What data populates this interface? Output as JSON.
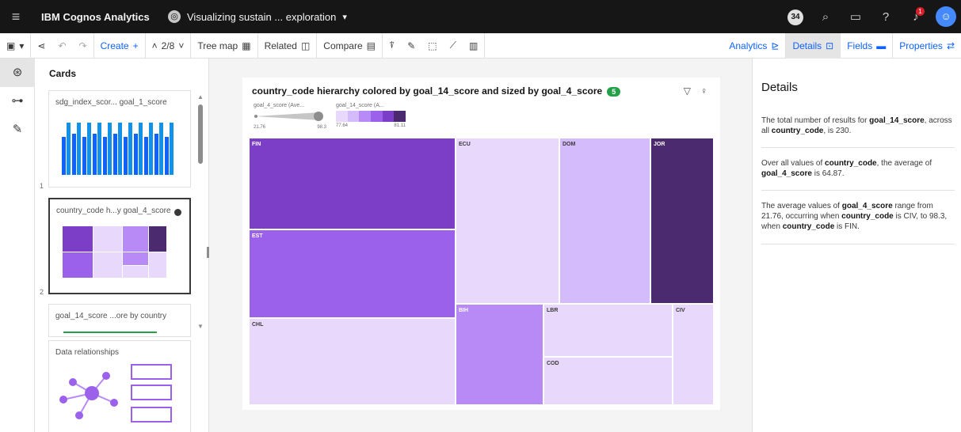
{
  "app": {
    "brand": "IBM Cognos Analytics",
    "doc_title": "Visualizing sustain ... exploration",
    "notification_count": "34",
    "alert_count": "1"
  },
  "toolbar": {
    "create": "Create",
    "page_indicator": "2/8",
    "tree_map": "Tree map",
    "related": "Related",
    "compare": "Compare",
    "analytics": "Analytics",
    "details": "Details",
    "fields": "Fields",
    "properties": "Properties"
  },
  "cards_panel": {
    "title": "Cards",
    "cards": [
      {
        "label": "sdg_index_scor... goal_1_score",
        "number": "1"
      },
      {
        "label": "country_code h...y goal_4_score",
        "number": "2"
      },
      {
        "label": "goal_14_score ...ore by country",
        "number": ""
      },
      {
        "label": "Data relationships",
        "number": ""
      }
    ]
  },
  "viz": {
    "title": "country_code hierarchy colored by goal_14_score and sized by goal_4_score",
    "badge": "5",
    "legend_size_label": "goal_4_score (Ave...",
    "legend_size_min": "21.76",
    "legend_size_max": "98.3",
    "legend_color_label": "goal_14_score (A...",
    "legend_color_min": "77.64",
    "legend_color_max": "81.11",
    "colors": [
      "#e8d9fc",
      "#d4bbfb",
      "#b88af5",
      "#9b61ea",
      "#7c3dc7",
      "#4c2a70"
    ]
  },
  "chart_data": {
    "type": "treemap",
    "title": "country_code hierarchy colored by goal_14_score and sized by goal_4_score",
    "size_measure": "goal_4_score (Ave...",
    "color_measure": "goal_14_score (A...",
    "size_range": [
      21.76,
      98.3
    ],
    "color_range": [
      77.64,
      81.11
    ],
    "nodes": [
      {
        "label": "FIN",
        "color_level": 4
      },
      {
        "label": "EST",
        "color_level": 3
      },
      {
        "label": "CHL",
        "color_level": 0
      },
      {
        "label": "ECU",
        "color_level": 0
      },
      {
        "label": "BIH",
        "color_level": 2
      },
      {
        "label": "DOM",
        "color_level": 1
      },
      {
        "label": "JOR",
        "color_level": 5
      },
      {
        "label": "LBR",
        "color_level": 0
      },
      {
        "label": "COD",
        "color_level": 0
      },
      {
        "label": "CIV",
        "color_level": 0
      }
    ]
  },
  "details_panel": {
    "heading": "Details",
    "item1_pre": "The total number of results for ",
    "item1_measure": "goal_14_score",
    "item1_mid": ", across all ",
    "item1_dim": "country_code",
    "item1_post": ", is 230.",
    "item2_pre": "Over all values of ",
    "item2_dim": "country_code",
    "item2_mid": ", the average of ",
    "item2_measure": "goal_4_score",
    "item2_post": " is 64.87.",
    "item3_pre": "The average values of ",
    "item3_measure": "goal_4_score",
    "item3_mid": " range from 21.76, occurring when ",
    "item3_dim1": "country_code",
    "item3_mid2": " is CIV, to 98.3, when ",
    "item3_dim2": "country_code",
    "item3_post": " is FIN."
  }
}
